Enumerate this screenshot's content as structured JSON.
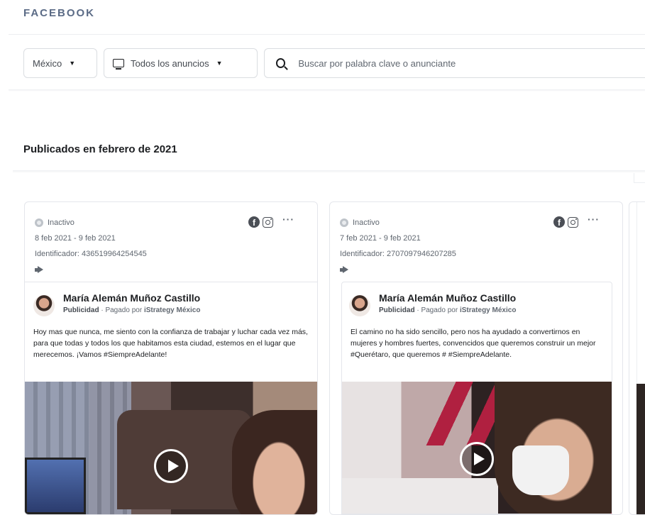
{
  "brand": "FACEBOOK",
  "filters": {
    "country": "México",
    "ad_type": "Todos los anuncios",
    "search_placeholder": "Buscar por palabra clave o anunciante"
  },
  "section_title": "Publicados en febrero de 2021",
  "cards": [
    {
      "status": "Inactivo",
      "dates": "8 feb 2021 - 9 feb 2021",
      "identifier": "Identificador: 436519964254545",
      "advertiser": "María Alemán Muñoz Castillo",
      "ad_label": "Publicidad",
      "paid_by_prefix": "· Pagado por",
      "sponsor": "iStrategy México",
      "text": "Hoy mas que nunca, me siento con la confianza de trabajar y luchar cada vez más, para que todas y todos los que habitamos esta ciudad, estemos en el lugar que merecemos. ¡Vamos #SiempreAdelante!"
    },
    {
      "status": "Inactivo",
      "dates": "7 feb 2021 - 9 feb 2021",
      "identifier": "Identificador: 2707097946207285",
      "advertiser": "María Alemán Muñoz Castillo",
      "ad_label": "Publicidad",
      "paid_by_prefix": "· Pagado por",
      "sponsor": "iStrategy México",
      "text": "El camino no ha sido sencillo, pero nos ha ayudado a convertirnos en mujeres y hombres fuertes, convencidos que queremos construir un mejor #Querétaro, que queremos # #SiempreAdelante."
    }
  ],
  "more_label": "···",
  "icons": {
    "status": "status-circle-icon",
    "facebook": "facebook-icon",
    "instagram": "instagram-icon",
    "megaphone": "megaphone-icon",
    "play": "play-icon",
    "search": "search-icon",
    "monitor": "monitor-icon",
    "caret": "caret-down-icon"
  }
}
